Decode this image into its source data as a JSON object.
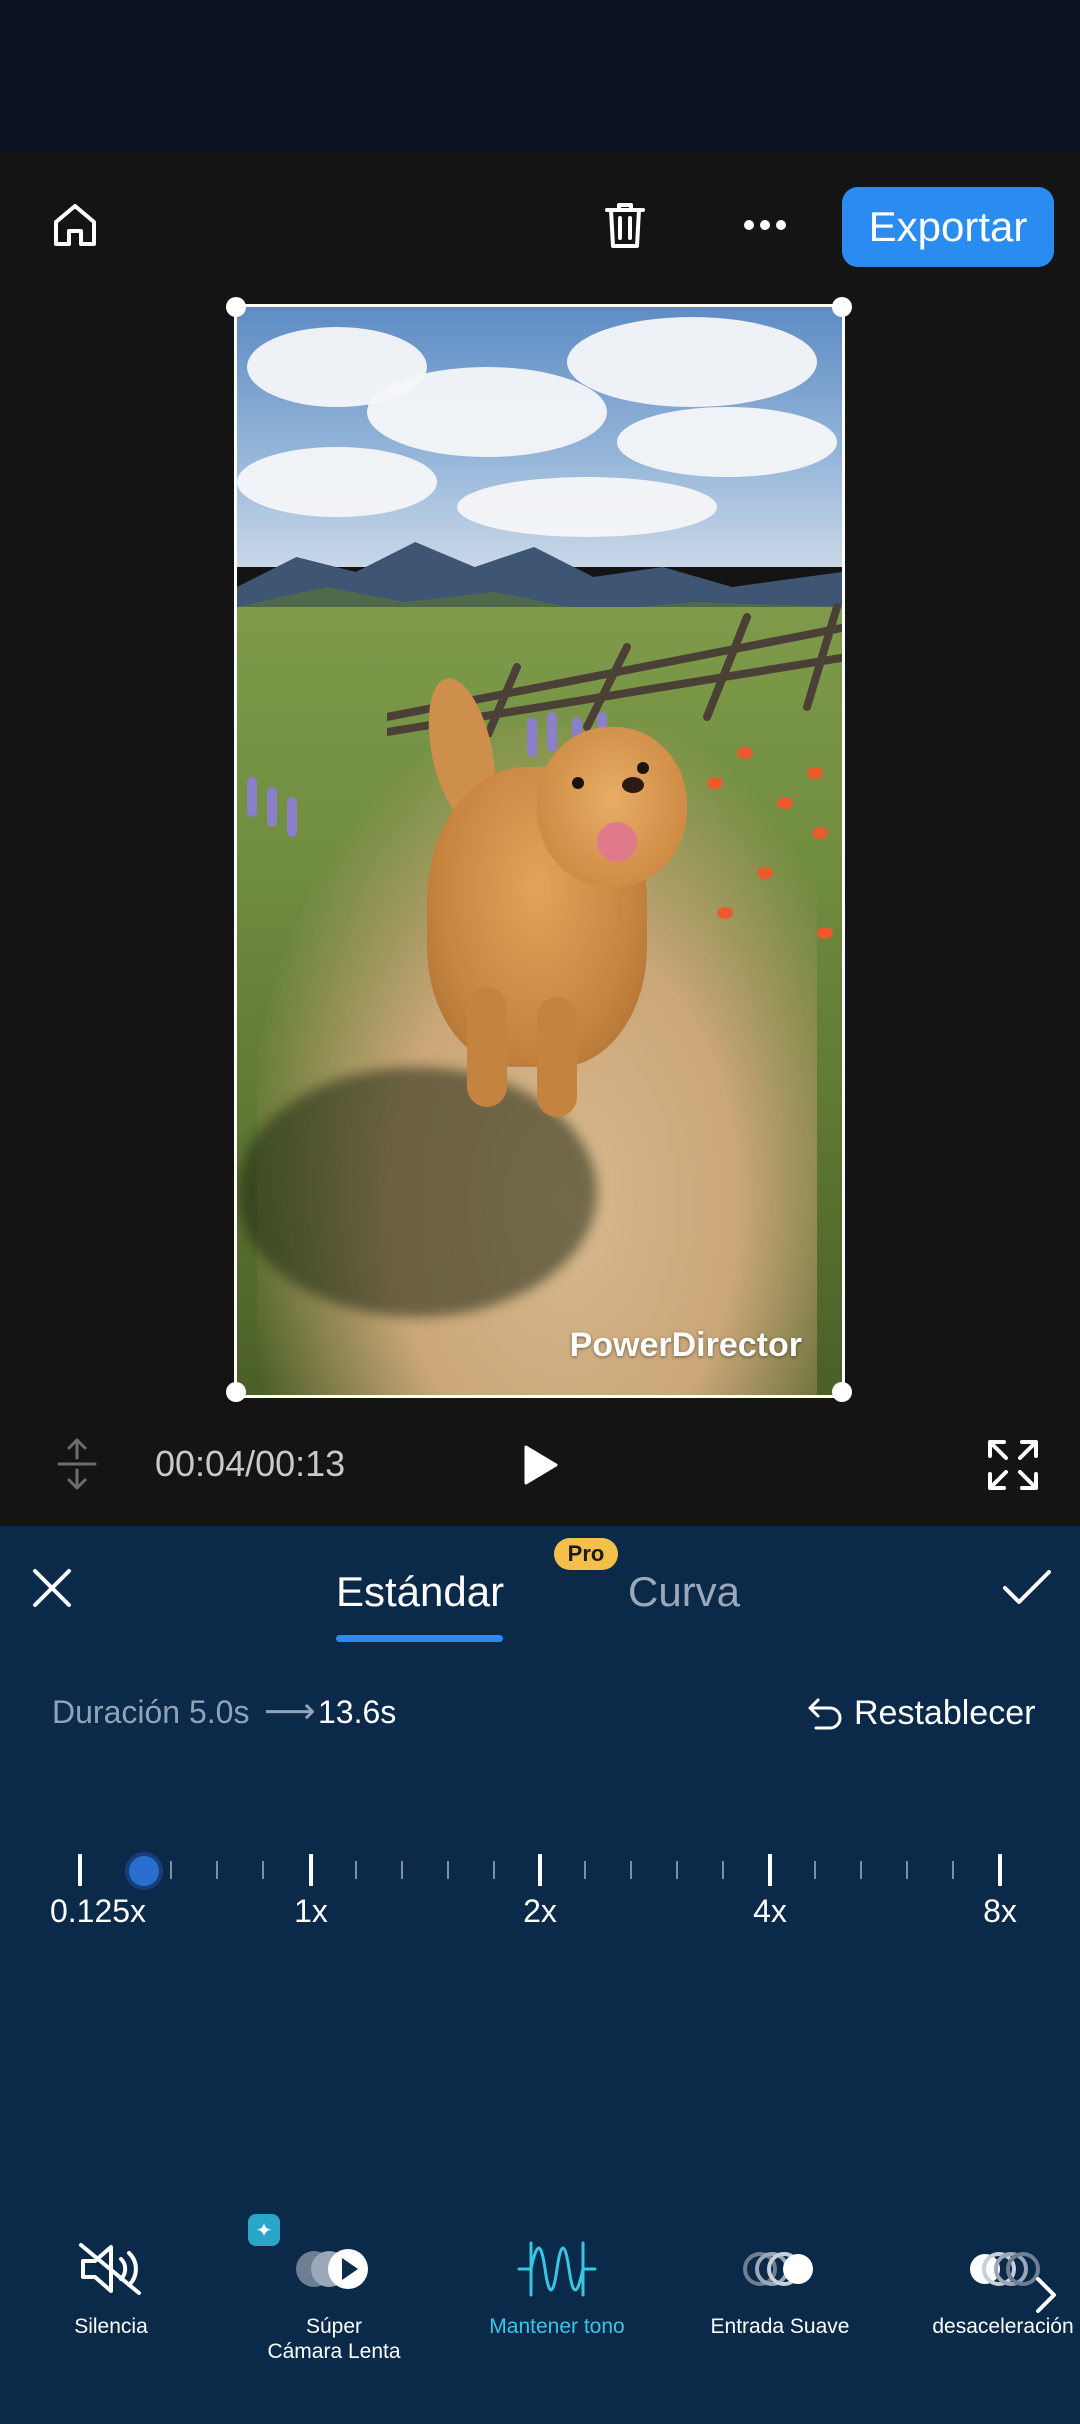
{
  "header": {
    "export_label": "Exportar"
  },
  "preview": {
    "watermark": "PowerDirector"
  },
  "playback": {
    "timecode": "00:04/00:13"
  },
  "speed_panel": {
    "tabs": [
      {
        "label": "Estándar",
        "active": true
      },
      {
        "label": "Curva",
        "active": false,
        "badge": "Pro"
      }
    ],
    "duration_label": "Duración 5.0s",
    "duration_arrow": "⟶",
    "duration_new": "13.6s",
    "reset_label": "Restablecer",
    "scale_labels": [
      "0.125x",
      "1x",
      "2x",
      "4x",
      "8x"
    ],
    "current_speed_position": 0.07
  },
  "tools": [
    {
      "label": "Silencia",
      "icon": "mute-icon",
      "active": false
    },
    {
      "label": "Súper\nCámara Lenta",
      "icon": "super-slow-motion-icon",
      "active": false,
      "badge": "ai-sparkle-icon"
    },
    {
      "label": "Mantener tono",
      "icon": "keep-pitch-waveform-icon",
      "active": true
    },
    {
      "label": "Entrada Suave",
      "icon": "ease-in-icon",
      "active": false
    },
    {
      "label": "desaceleración",
      "icon": "ease-out-icon",
      "active": false
    }
  ],
  "colors": {
    "accent": "#2a8cf0",
    "panel_bg": "#0b2a4a",
    "active_tool": "#36c6e6",
    "pro_badge": "#f5c04a"
  }
}
